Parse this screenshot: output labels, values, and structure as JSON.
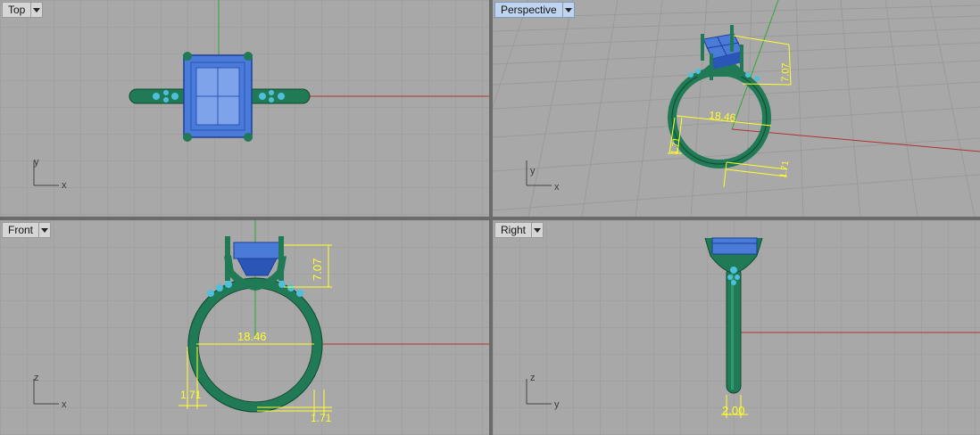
{
  "viewports": {
    "top": {
      "label": "Top",
      "axes": {
        "a": "y",
        "b": "x"
      }
    },
    "perspective": {
      "label": "Perspective",
      "axes": {
        "a": "y",
        "b": "x"
      }
    },
    "front": {
      "label": "Front",
      "axes": {
        "a": "z",
        "b": "x"
      }
    },
    "right": {
      "label": "Right",
      "axes": {
        "a": "z",
        "b": "y"
      }
    }
  },
  "dimensions": {
    "height": "7.07",
    "diameter": "18.46",
    "band_thickness": "1.71",
    "band_width": "2.00"
  },
  "colors": {
    "viewport_bg": "#a8a8a8",
    "grid_line": "#9c9c9c",
    "x_axis": "#b03232",
    "y_axis": "#2da82d",
    "ring_metal": "#1f7a55",
    "gem": "#4a7bd9",
    "accent_stones": "#4fc0dc",
    "dimension": "#ffff2a",
    "active_tab": "#bfd4ee"
  }
}
